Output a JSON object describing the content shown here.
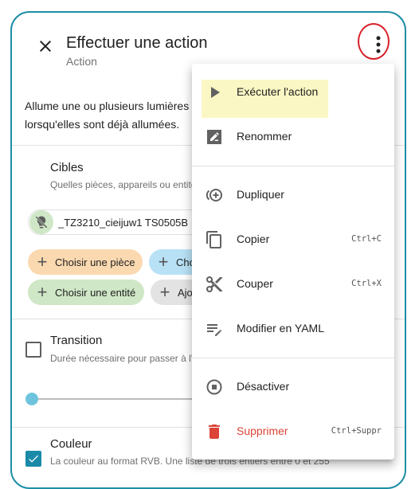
{
  "dialog": {
    "title": "Effectuer une action",
    "subtitle": "Action",
    "description": "Allume une ou plusieurs lumières ou les modifie lorsqu'elles sont déjà allumées."
  },
  "targets": {
    "title": "Cibles",
    "help": "Quelles pièces, appareils ou entités",
    "device_chip": "_TZ3210_cieijuw1 TS0505B",
    "remove_symbol": "×",
    "buttons": {
      "room": "Choisir une pièce",
      "device": "Choi",
      "entity": "Choisir une entité",
      "label": "Ajo"
    },
    "plus_symbol": "+"
  },
  "transition": {
    "title": "Transition",
    "help": "Durée nécessaire pour passer à l'é"
  },
  "color": {
    "title": "Couleur",
    "help": "La couleur au format RVB. Une liste de trois entiers entre 0 et 255"
  },
  "menu": {
    "run": "Exécuter l'action",
    "rename": "Renommer",
    "duplicate": "Dupliquer",
    "copy": "Copier",
    "copy_shortcut": "Ctrl+C",
    "cut": "Couper",
    "cut_shortcut": "Ctrl+X",
    "yaml": "Modifier en YAML",
    "disable": "Désactiver",
    "delete": "Supprimer",
    "delete_shortcut": "Ctrl+Suppr"
  },
  "colors": {
    "accent": "#1a8aa8",
    "room_chip": "#fbd9b0",
    "device_chip": "#b8e1f5",
    "entity_chip": "#cfe7c6",
    "label_chip": "#e3e3e3",
    "highlight": "#fbf7c4",
    "danger": "#db4437",
    "annotation_ring": "#d9202a"
  }
}
